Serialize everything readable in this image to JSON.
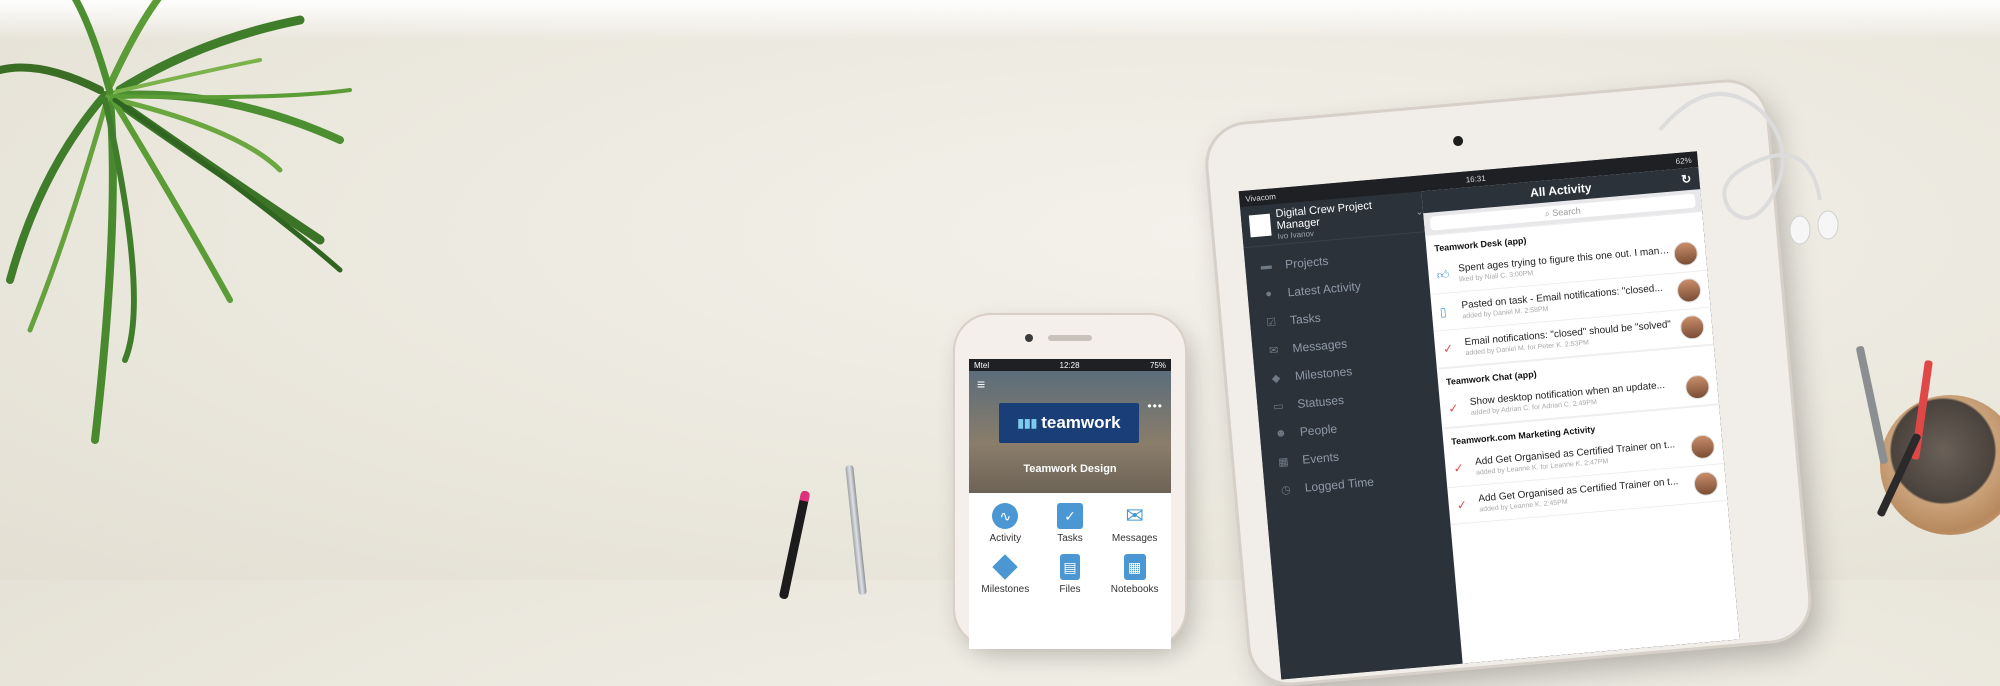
{
  "phone": {
    "status": {
      "carrier": "Mtel",
      "time": "12:28",
      "battery": "75%"
    },
    "logo_text": "teamwork",
    "project_title": "Teamwork Design",
    "grid": [
      {
        "label": "Activity",
        "icon": "activity-icon"
      },
      {
        "label": "Tasks",
        "icon": "tasks-icon"
      },
      {
        "label": "Messages",
        "icon": "messages-icon"
      },
      {
        "label": "Milestones",
        "icon": "milestones-icon"
      },
      {
        "label": "Files",
        "icon": "files-icon"
      },
      {
        "label": "Notebooks",
        "icon": "notebooks-icon"
      }
    ]
  },
  "ipad": {
    "status": {
      "carrier": "Vivacom",
      "time": "16:31",
      "battery": "62%"
    },
    "sidebar": {
      "org": "Digital Crew Project Manager",
      "user": "Ivo Ivanov",
      "items": [
        {
          "label": "Projects",
          "icon": "folder-icon"
        },
        {
          "label": "Latest Activity",
          "icon": "clock-icon"
        },
        {
          "label": "Tasks",
          "icon": "checkbox-icon"
        },
        {
          "label": "Messages",
          "icon": "envelope-icon"
        },
        {
          "label": "Milestones",
          "icon": "diamond-icon"
        },
        {
          "label": "Statuses",
          "icon": "speech-icon"
        },
        {
          "label": "People",
          "icon": "people-icon"
        },
        {
          "label": "Events",
          "icon": "calendar-icon"
        },
        {
          "label": "Logged Time",
          "icon": "stopwatch-icon"
        }
      ]
    },
    "main": {
      "title": "All Activity",
      "search_placeholder": "Search",
      "groups": [
        {
          "name": "Teamwork Desk (app)",
          "rows": [
            {
              "text": "Spent ages trying to figure this one out. I manag...",
              "meta": "liked by Niall C. 3:00PM",
              "icon": "like"
            },
            {
              "text": "Pasted on task - Email notifications: \"closed...",
              "meta": "added by Daniel M. 2:58PM",
              "icon": "doc"
            },
            {
              "text": "Email notifications: \"closed\" should be \"solved\"",
              "meta": "added by Daniel M. for Peter K. 2:53PM",
              "icon": "check"
            }
          ]
        },
        {
          "name": "Teamwork Chat (app)",
          "rows": [
            {
              "text": "Show desktop notification when an update...",
              "meta": "added by Adrian C. for Adrian C. 2:49PM",
              "icon": "check"
            }
          ]
        },
        {
          "name": "Teamwork.com Marketing Activity",
          "rows": [
            {
              "text": "Add Get Organised as Certified Trainer on t...",
              "meta": "added by Leanne K. for Leanne K. 2:47PM",
              "icon": "check"
            },
            {
              "text": "Add Get Organised as Certified Trainer on t...",
              "meta": "added by Leanne K. 2:45PM",
              "icon": "check"
            }
          ]
        }
      ]
    }
  },
  "colors": {
    "accent": "#4a97d3",
    "sidebar": "#2c323a",
    "check_red": "#e34c4c",
    "brand_navy": "#1a3f78"
  }
}
